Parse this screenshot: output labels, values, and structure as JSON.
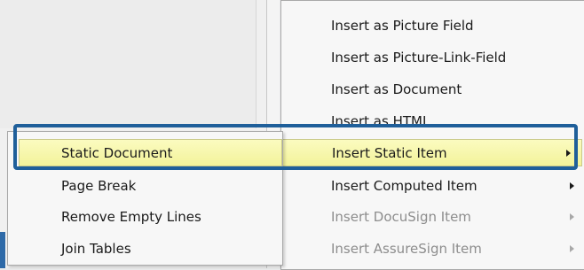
{
  "colors": {
    "highlight": "#f6f6a8",
    "focus_frame": "#1f5f9a",
    "disabled_text": "#8d8d8d",
    "menu_bg": "#f7f7f7"
  },
  "left_menu": {
    "items": [
      {
        "label": "Static Document",
        "highlighted": true
      },
      {
        "label": "Page Break"
      },
      {
        "label": "Remove Empty Lines"
      },
      {
        "label": "Join Tables"
      }
    ]
  },
  "right_menu": {
    "items": [
      {
        "label": "Insert as Picture Field"
      },
      {
        "label": "Insert as Picture-Link-Field"
      },
      {
        "label": "Insert as Document"
      },
      {
        "label": "Insert as HTML"
      },
      {
        "label": "Insert Static Item",
        "highlighted": true,
        "submenu": true
      },
      {
        "label": "Insert Computed Item",
        "submenu": true
      },
      {
        "label": "Insert DocuSign Item",
        "disabled": true,
        "submenu": true
      },
      {
        "label": "Insert AssureSign Item",
        "disabled": true,
        "submenu": true
      }
    ]
  }
}
